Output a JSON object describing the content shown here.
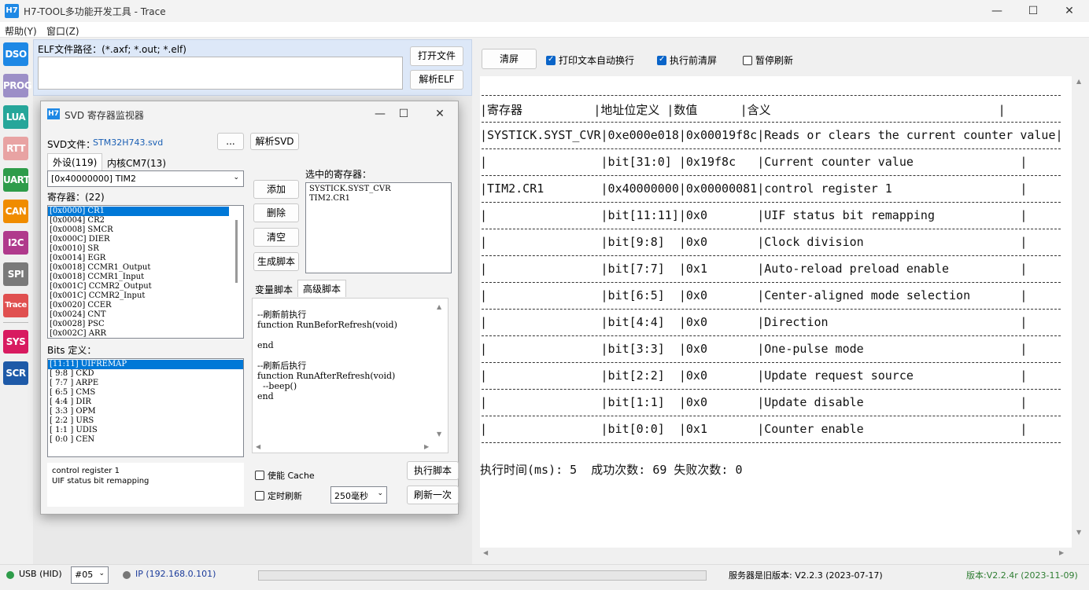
{
  "window": {
    "title": "H7-TOOL多功能开发工具 - Trace",
    "icon": "H7"
  },
  "menubar": [
    {
      "label": "帮助(Y)"
    },
    {
      "label": "窗口(Z)"
    }
  ],
  "leftnav": [
    {
      "label": "DSO",
      "color": "#1e88e5"
    },
    {
      "label": "PROG",
      "color": "#9c8fc7"
    },
    {
      "label": "LUA",
      "color": "#26a69a"
    },
    {
      "label": "RTT",
      "color": "#e8a3a3"
    },
    {
      "label": "UART",
      "color": "#2e9c4a"
    },
    {
      "label": "CAN",
      "color": "#f08c00"
    },
    {
      "label": "I2C",
      "color": "#b03a8c"
    },
    {
      "label": "SPI",
      "color": "#7a7a7a"
    },
    {
      "label": "Trace",
      "color": "#e05050"
    },
    {
      "label": "SYS",
      "color": "#d81b60"
    },
    {
      "label": "SCR",
      "color": "#1e5aa8"
    }
  ],
  "elf": {
    "label": "ELF文件路径：(*.axf; *.out; *.elf)",
    "path": "",
    "open_btn": "打开文件",
    "parse_btn": "解析ELF"
  },
  "svd": {
    "title": "SVD 寄存器监视器",
    "icon": "H7",
    "file_label": "SVD文件：",
    "file_name": "STM32H743.svd",
    "browse_btn": "...",
    "parse_btn": "解析SVD",
    "tabs": [
      "外设(119)",
      "内核CM7(13)"
    ],
    "peripheral_combo": "[0x40000000] TIM2",
    "registers_label": "寄存器：(22)",
    "registers": [
      "[0x0000] CR1",
      "[0x0004] CR2",
      "[0x0008] SMCR",
      "[0x000C] DIER",
      "[0x0010] SR",
      "[0x0014] EGR",
      "[0x0018] CCMR1_Output",
      "[0x0018] CCMR1_Input",
      "[0x001C] CCMR2_Output",
      "[0x001C] CCMR2_Input",
      "[0x0020] CCER",
      "[0x0024] CNT",
      "[0x0028] PSC",
      "[0x002C] ARR"
    ],
    "bits_label": "Bits 定义：",
    "bits": [
      "[11:11] UIFREMAP",
      "[ 9:8 ] CKD",
      "[ 7:7 ] ARPE",
      "[ 6:5 ] CMS",
      "[ 4:4 ] DIR",
      "[ 3:3 ] OPM",
      "[ 2:2 ] URS",
      "[ 1:1 ] UDIS",
      "[ 0:0 ] CEN"
    ],
    "description": [
      "control register 1",
      "UIF status bit remapping"
    ],
    "buttons": {
      "add": "添加",
      "delete": "删除",
      "clear": "清空",
      "gen": "生成脚本"
    },
    "selected_label": "选中的寄存器：",
    "selected": [
      "SYSTICK.SYST_CVR",
      "TIM2.CR1"
    ],
    "script_tabs": [
      "变量脚本",
      "高级脚本"
    ],
    "script": [
      "--刷新前执行",
      "function RunBeforRefresh(void)",
      "",
      "end",
      "",
      "--刷新后执行",
      "function RunAfterRefresh(void)",
      "  --beep()",
      "end"
    ],
    "cache_label": "使能 Cache",
    "timer_label": "定时刷新",
    "interval": "250毫秒",
    "run_btn": "执行脚本",
    "refresh_btn": "刷新一次"
  },
  "right": {
    "clear_btn": "清屏",
    "opts": [
      {
        "label": "打印文本自动换行",
        "checked": true
      },
      {
        "label": "执行前清屏",
        "checked": true
      },
      {
        "label": "暂停刷新",
        "checked": false
      }
    ]
  },
  "table": {
    "header": "|寄存器          |地址位定义 |数值      |含义                                |",
    "rows": [
      "|SYSTICK.SYST_CVR|0xe000e018|0x00019f8c|Reads or clears the current counter value|",
      "|                |bit[31:0] |0x19f8c   |Current counter value               |",
      "|TIM2.CR1        |0x40000000|0x00000081|control register 1                  |",
      "|                |bit[11:11]|0x0       |UIF status bit remapping            |",
      "|                |bit[9:8]  |0x0       |Clock division                      |",
      "|                |bit[7:7]  |0x1       |Auto-reload preload enable          |",
      "|                |bit[6:5]  |0x0       |Center-aligned mode selection       |",
      "|                |bit[4:4]  |0x0       |Direction                           |",
      "|                |bit[3:3]  |0x0       |One-pulse mode                      |",
      "|                |bit[2:2]  |0x0       |Update request source               |",
      "|                |bit[1:1]  |0x0       |Update disable                      |",
      "|                |bit[0:0]  |0x1       |Counter enable                      |"
    ],
    "footer": "执行时间(ms): 5  成功次数: 69 失败次数: 0"
  },
  "status": {
    "usb": "USB (HID)",
    "port": "#05",
    "ip": "IP (192.168.0.101)",
    "server": "服务器是旧版本: V2.2.3 (2023-07-17)",
    "version": "版本:V2.2.4r (2023-11-09)"
  }
}
